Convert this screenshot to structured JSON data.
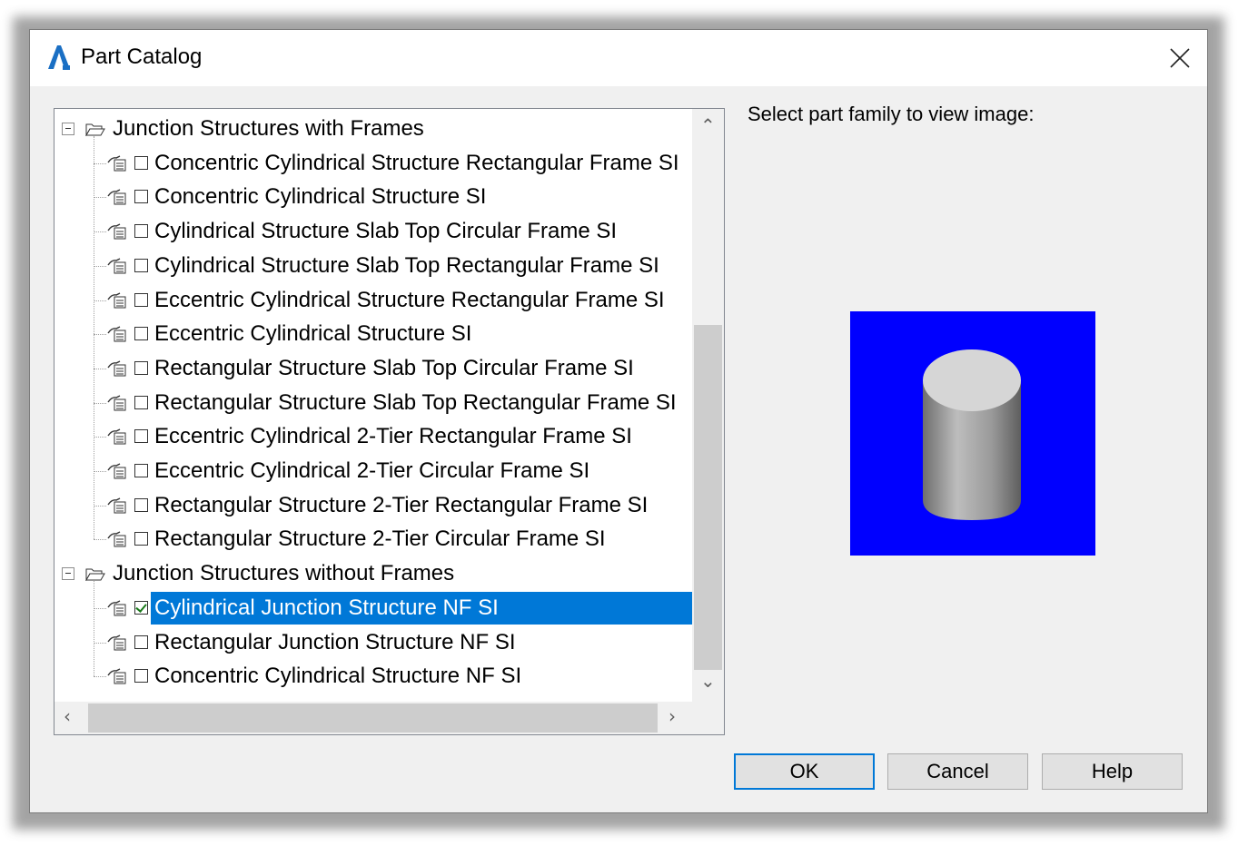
{
  "window": {
    "title": "Part Catalog"
  },
  "prompt": "Select part family to view image:",
  "tree": {
    "groups": [
      {
        "label": "Junction Structures with Frames",
        "items": [
          {
            "label": "Concentric Cylindrical Structure Rectangular Frame SI",
            "checked": false
          },
          {
            "label": "Concentric Cylindrical Structure SI",
            "checked": false
          },
          {
            "label": "Cylindrical Structure Slab Top Circular Frame SI",
            "checked": false
          },
          {
            "label": "Cylindrical Structure Slab Top Rectangular Frame SI",
            "checked": false
          },
          {
            "label": "Eccentric Cylindrical Structure Rectangular Frame SI",
            "checked": false
          },
          {
            "label": "Eccentric Cylindrical Structure SI",
            "checked": false
          },
          {
            "label": "Rectangular Structure Slab Top Circular Frame SI",
            "checked": false
          },
          {
            "label": "Rectangular Structure Slab Top Rectangular Frame SI",
            "checked": false
          },
          {
            "label": "Eccentric Cylindrical 2-Tier Rectangular Frame SI",
            "checked": false
          },
          {
            "label": "Eccentric Cylindrical 2-Tier Circular Frame SI",
            "checked": false
          },
          {
            "label": "Rectangular Structure 2-Tier Rectangular Frame SI",
            "checked": false
          },
          {
            "label": "Rectangular Structure 2-Tier Circular Frame SI",
            "checked": false
          }
        ]
      },
      {
        "label": "Junction Structures without Frames",
        "items": [
          {
            "label": "Cylindrical Junction Structure NF SI",
            "checked": true,
            "selected": true
          },
          {
            "label": "Rectangular Junction Structure NF SI",
            "checked": false
          },
          {
            "label": "Concentric Cylindrical Structure NF SI",
            "checked": false
          }
        ]
      }
    ]
  },
  "buttons": {
    "ok": "OK",
    "cancel": "Cancel",
    "help": "Help"
  },
  "colors": {
    "selection": "#0078d7",
    "preview_background": "#0000ff"
  },
  "icons": [
    "autocad-app-icon",
    "close-icon",
    "folder-open-icon",
    "part-family-icon",
    "checkbox",
    "scroll-up-icon",
    "scroll-down-icon",
    "scroll-left-icon",
    "scroll-right-icon"
  ]
}
